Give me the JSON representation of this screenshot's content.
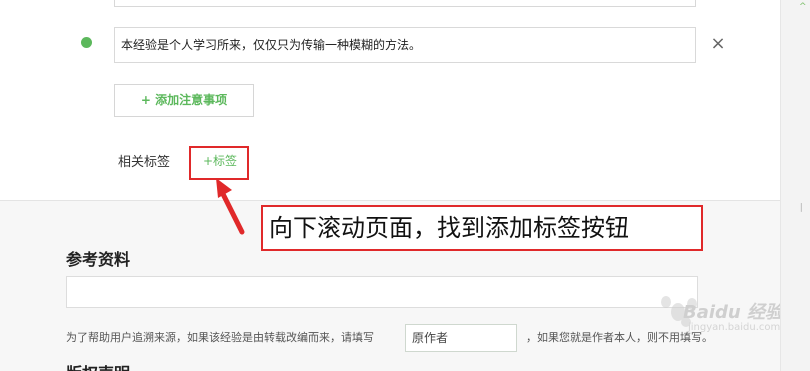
{
  "note": {
    "text": "本经验是个人学习所来，仅仅只为传输一种模糊的方法。",
    "remove_icon": "×"
  },
  "add_note_button": "+ 添加注意事项",
  "tags": {
    "label": "相关标签",
    "add_tag": "+标签"
  },
  "callout": {
    "text": "向下滚动页面，找到添加标签按钮",
    "color": "#e0292a"
  },
  "reference": {
    "title": "参考资料",
    "hint_before": "为了帮助用户追溯来源，如果该经验是由转载改编而来，请填写",
    "author_placeholder": "原作者",
    "hint_after": "，如果您就是作者本人，则不用填写。"
  },
  "next_section_title": "版权声明",
  "watermark": {
    "brand": "Baidu 经验",
    "sub": "jingyan.baidu.com"
  },
  "colors": {
    "accent_green": "#5cb85c",
    "highlight_red": "#e0292a"
  }
}
